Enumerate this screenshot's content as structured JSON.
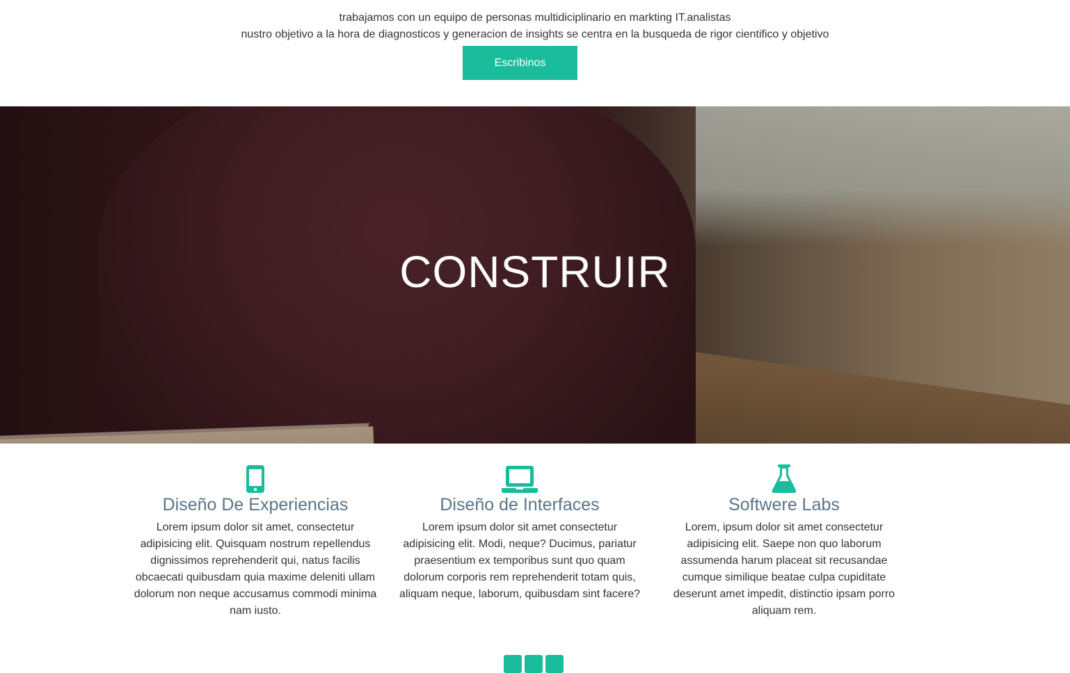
{
  "colors": {
    "accent": "#1abc9c",
    "heading": "#5b7486",
    "text": "#333333"
  },
  "intro": {
    "cutoff_text": "...",
    "line1": "trabajamos con un equipo de personas multidiciplinario en markting IT.analistas",
    "line2": "nustro objetivo a la hora de diagnosticos y generacion de insights se centra en la busqueda de rigor cientifico y objetivo",
    "cta_label": "Escribinos"
  },
  "hero": {
    "title": "CONSTRUIR"
  },
  "features": [
    {
      "icon": "mobile-phone-icon",
      "title": "Diseño De Experiencias",
      "text": "Lorem ipsum dolor sit amet, consectetur adipisicing elit. Quisquam nostrum repellendus dignissimos reprehenderit qui, natus facilis obcaecati quibusdam quia maxime deleniti ullam dolorum non neque accusamus commodi minima nam iusto."
    },
    {
      "icon": "laptop-icon",
      "title": "Diseño de Interfaces",
      "text": "Lorem ipsum dolor sit amet consectetur adipisicing elit. Modi, neque? Ducimus, pariatur praesentium ex temporibus sunt quo quam dolorum corporis rem reprehenderit totam quis, aliquam neque, laborum, quibusdam sint facere?"
    },
    {
      "icon": "flask-icon",
      "title": "Softwere Labs",
      "text": "Lorem, ipsum dolor sit amet consectetur adipisicing elit. Saepe non quo laborum assumenda harum placeat sit recusandae cumque similique beatae culpa cupiditate deserunt amet impedit, distinctio ipsam porro aliquam rem."
    }
  ],
  "social_icons": [
    "social-icon-1",
    "social-icon-2",
    "social-icon-3"
  ]
}
